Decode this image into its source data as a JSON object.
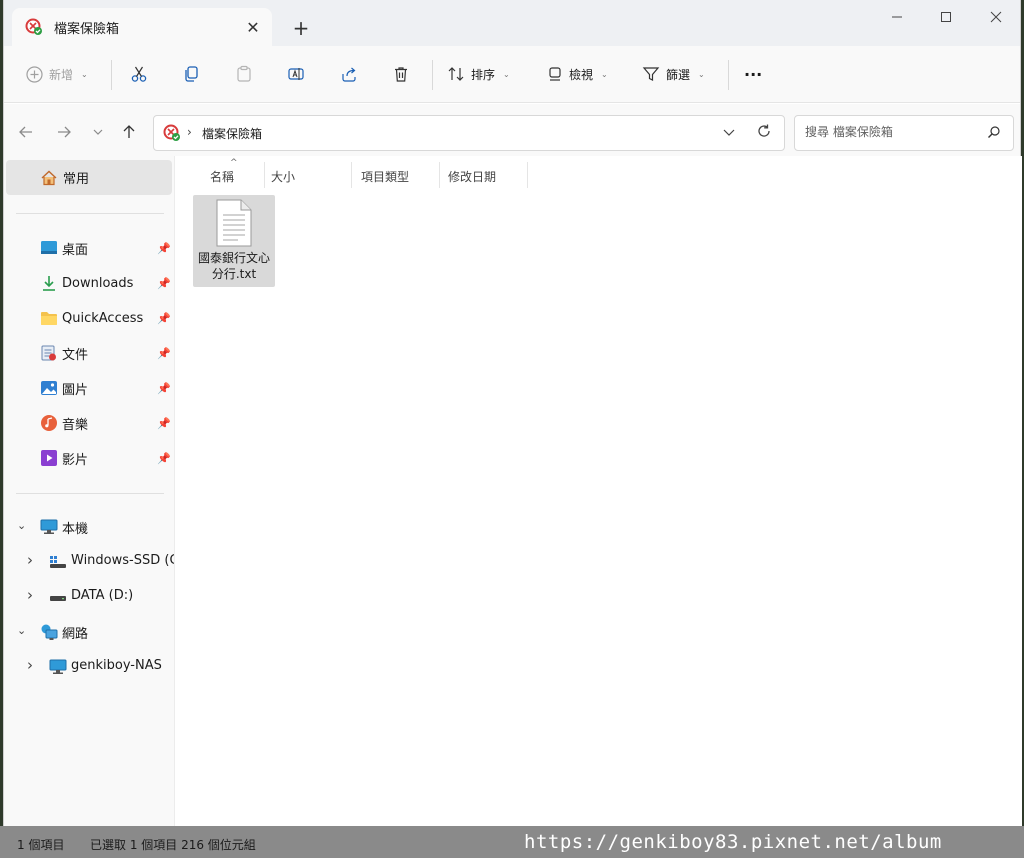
{
  "tab": {
    "title": "檔案保險箱",
    "close": "✕",
    "new": "+"
  },
  "window_controls": {
    "minimize": "—",
    "maximize": "☐",
    "close": "✕"
  },
  "toolbar": {
    "new_label": "新增",
    "sort_label": "排序",
    "view_label": "檢視",
    "filter_label": "篩選",
    "more": "···"
  },
  "address": {
    "path": "檔案保險箱",
    "search_placeholder": "搜尋 檔案保險箱"
  },
  "sidebar": {
    "home": "常用",
    "quick": [
      {
        "label": "桌面",
        "icon": "desktop-icon"
      },
      {
        "label": "Downloads",
        "icon": "download-icon"
      },
      {
        "label": "QuickAccess",
        "icon": "folder-icon"
      },
      {
        "label": "文件",
        "icon": "documents-icon"
      },
      {
        "label": "圖片",
        "icon": "pictures-icon"
      },
      {
        "label": "音樂",
        "icon": "music-icon"
      },
      {
        "label": "影片",
        "icon": "videos-icon"
      }
    ],
    "tree": [
      {
        "label": "本機",
        "arrow": "⌄"
      },
      {
        "label": "Windows-SSD (C:)",
        "arrow": "›"
      },
      {
        "label": "DATA (D:)",
        "arrow": "›"
      },
      {
        "label": "網路",
        "arrow": "⌄"
      },
      {
        "label": "genkiboy-NAS",
        "arrow": "›"
      }
    ]
  },
  "columns": [
    "名稱",
    "大小",
    "項目類型",
    "修改日期"
  ],
  "files": [
    {
      "name": "國泰銀行文心分行.txt",
      "icon": "text-file-icon"
    }
  ],
  "status": {
    "count": "1 個項目",
    "selected": "已選取 1 個項目  216 個位元組"
  },
  "watermark": "https://genkiboy83.pixnet.net/album",
  "colors": {
    "accent": "#0067c0",
    "selection": "#d9d9d9",
    "statusbar": "#8a8a8a"
  }
}
